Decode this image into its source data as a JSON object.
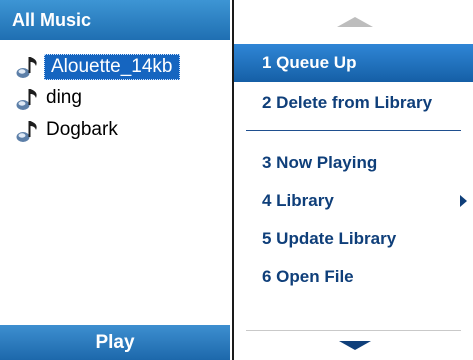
{
  "library": {
    "header": "All Music",
    "tracks": [
      {
        "title": "Alouette_14kb",
        "selected": true
      },
      {
        "title": "ding",
        "selected": false
      },
      {
        "title": "Dogbark",
        "selected": false
      }
    ],
    "icon": "music-note-icon"
  },
  "softkey": {
    "left_label": "Play"
  },
  "menu": {
    "items": [
      {
        "label": "1 Queue Up",
        "selected": true,
        "has_submenu": false
      },
      {
        "label": "2 Delete from Library",
        "selected": false,
        "has_submenu": false
      },
      {
        "label": "3 Now Playing",
        "selected": false,
        "has_submenu": false
      },
      {
        "label": "4 Library",
        "selected": false,
        "has_submenu": true
      },
      {
        "label": "5 Update Library",
        "selected": false,
        "has_submenu": false
      },
      {
        "label": "6 Open File",
        "selected": false,
        "has_submenu": false
      }
    ],
    "scroll_up_icon": "scroll-up-arrow-icon",
    "scroll_down_icon": "scroll-down-arrow-icon",
    "submenu_icon": "submenu-arrow-icon"
  },
  "colors": {
    "accent": "#1f6fb2",
    "menu_text": "#0f3f7a",
    "selection": "#155fa6"
  }
}
